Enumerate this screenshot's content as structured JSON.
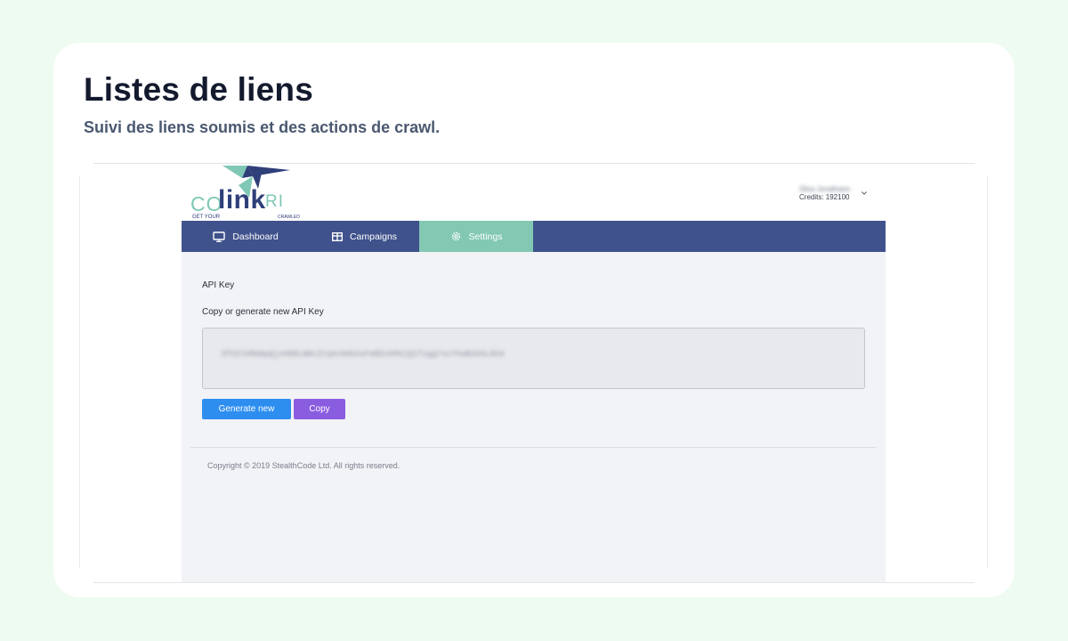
{
  "page": {
    "title": "Listes de liens",
    "subtitle": "Suivi des liens soumis et des actions de crawl."
  },
  "app": {
    "logo": {
      "co": "CO",
      "link": "link",
      "ri": "RI",
      "tagline_left": "GET YOUR",
      "tagline_right": "CRAWLED"
    },
    "user": {
      "name": "Silva Jonathane",
      "credits": "Credits: 192100"
    },
    "nav": {
      "items": [
        {
          "label": "Dashboard",
          "icon": "monitor-icon"
        },
        {
          "label": "Campaigns",
          "icon": "table-icon"
        },
        {
          "label": "Settings",
          "icon": "gear-icon",
          "active": true
        }
      ]
    },
    "settings": {
      "heading": "API Key",
      "description": "Copy or generate new API Key",
      "api_key": "3fCOlkRm8pQjxH0DLW8cZtqXn9dkAsFeBZvkM4jQ1Tsgg7xcYhaB2bSL8C6",
      "generate_label": "Generate new",
      "copy_label": "Copy"
    },
    "footer": {
      "copyright": "Copyright © 2019 StealthCode Ltd. All rights reserved."
    }
  },
  "colors": {
    "navbar": "#3f528c",
    "nav_active": "#83c8b3",
    "generate_button": "#2d8ef0",
    "copy_button": "#8a5ce0",
    "background": "#eefbf1"
  }
}
